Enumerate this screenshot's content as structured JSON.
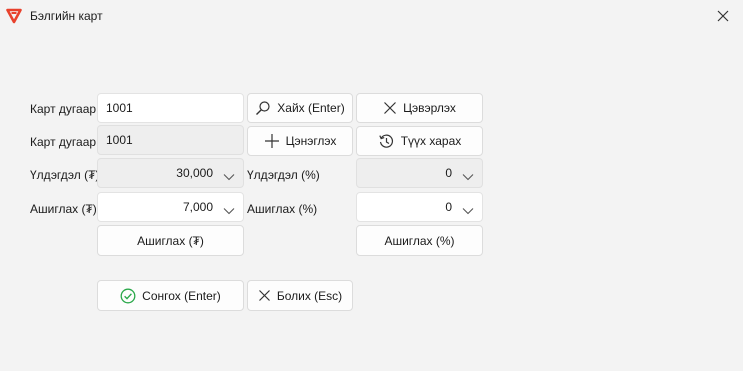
{
  "window": {
    "title": "Бэлгийн карт",
    "logo_icon": "app-logo-icon",
    "close_icon": "close-icon",
    "accent": "#e8412c"
  },
  "form": {
    "card_label": "Карт дугаар",
    "card_input_value": "1001",
    "card_label_2": "Карт дугаар",
    "card_display_value": "1001",
    "balance_amount_label": "Үлдэгдэл (₮)",
    "balance_amount_value": "30,000",
    "use_amount_label": "Ашиглах (₮)",
    "use_amount_value": "7,000",
    "balance_percent_label": "Үлдэгдэл (%)",
    "balance_percent_value": "0",
    "use_percent_label": "Ашиглах (%)",
    "use_percent_value": "0"
  },
  "buttons": {
    "search": "Хайх (Enter)",
    "clear": "Цэвэрлэх",
    "topup": "Цэнэглэх",
    "history": "Түүх харах",
    "use_amount": "Ашиглах (₮)",
    "use_percent": "Ашиглах (%)",
    "select": "Сонгох (Enter)",
    "cancel": "Болих (Esc)"
  },
  "colors": {
    "success": "#2aa84a"
  }
}
